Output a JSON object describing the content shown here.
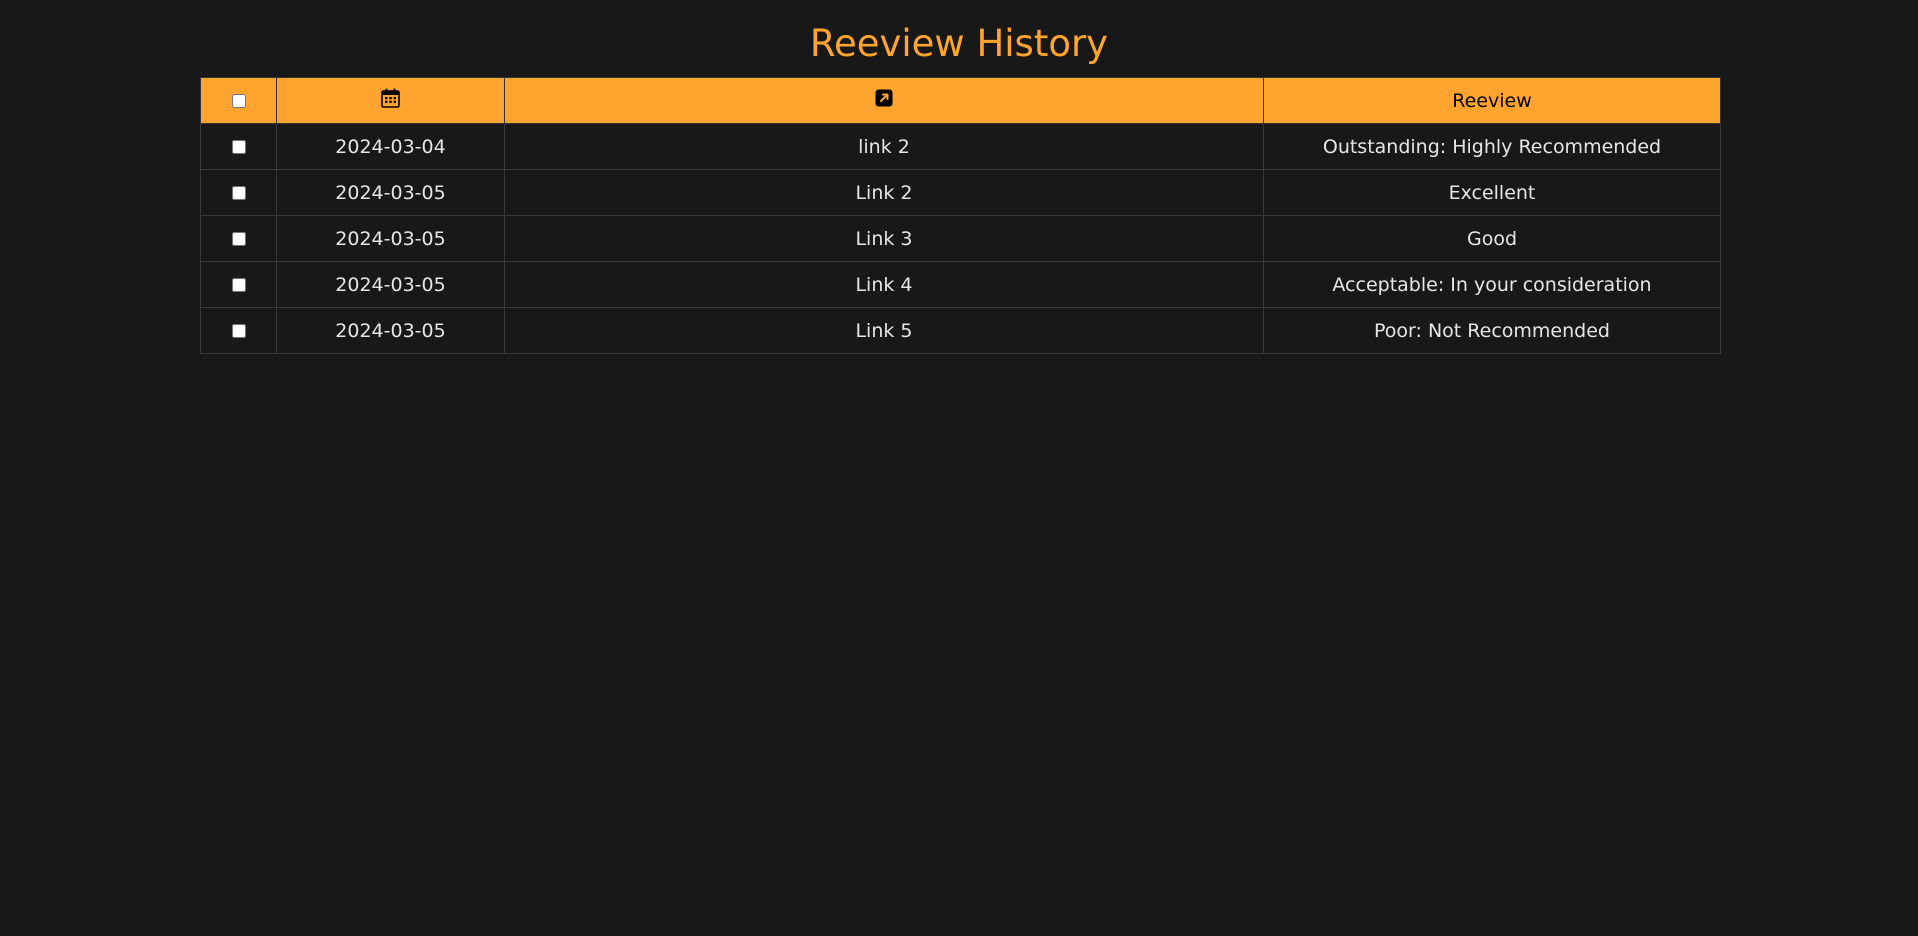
{
  "page": {
    "title": "Reeview History"
  },
  "table": {
    "headers": {
      "select_all": false,
      "date_icon": "calendar-icon",
      "link_icon": "external-link-icon",
      "review": "Reeview"
    },
    "rows": [
      {
        "checked": false,
        "date": "2024-03-04",
        "link": "link 2",
        "review": "Outstanding: Highly Recommended"
      },
      {
        "checked": false,
        "date": "2024-03-05",
        "link": "Link 2",
        "review": "Excellent"
      },
      {
        "checked": false,
        "date": "2024-03-05",
        "link": "Link 3",
        "review": "Good"
      },
      {
        "checked": false,
        "date": "2024-03-05",
        "link": "Link 4",
        "review": "Acceptable: In your consideration"
      },
      {
        "checked": false,
        "date": "2024-03-05",
        "link": "Link 5",
        "review": "Poor: Not Recommended"
      }
    ]
  },
  "colors": {
    "background": "#181818",
    "accent": "#FFA42E",
    "text": "#e6e6e6",
    "border": "#3a3a3a"
  }
}
